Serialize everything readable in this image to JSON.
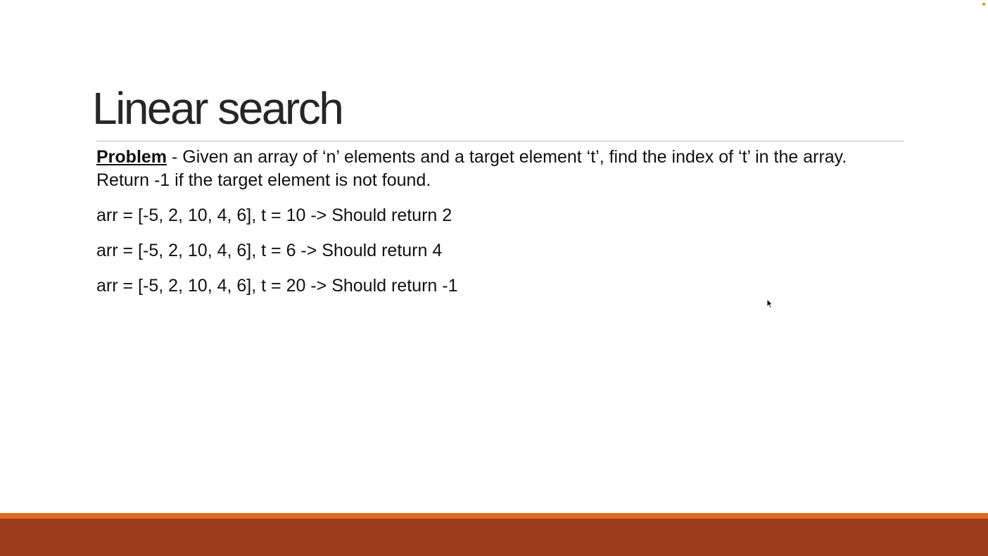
{
  "slide": {
    "title": "Linear search",
    "problem_label": "Problem",
    "problem_text": " - Given an array of ‘n’ elements and a target element ‘t’, find the index of ‘t’ in the array. Return -1 if the target element is not found.",
    "examples": [
      "arr = [-5, 2, 10, 4, 6], t = 10 -> Should return 2",
      "arr = [-5, 2, 10, 4, 6], t = 6 -> Should return 4",
      "arr = [-5, 2, 10, 4, 6], t = 20 -> Should return -1"
    ]
  },
  "theme": {
    "accent_strip": "#e06a21",
    "footer_band": "#9c3b1e",
    "corner_dot": "#e8812e",
    "title_color": "#262626",
    "rule_color": "#bcbcbc"
  },
  "icons": {
    "pointer": "mouse-pointer-icon"
  }
}
